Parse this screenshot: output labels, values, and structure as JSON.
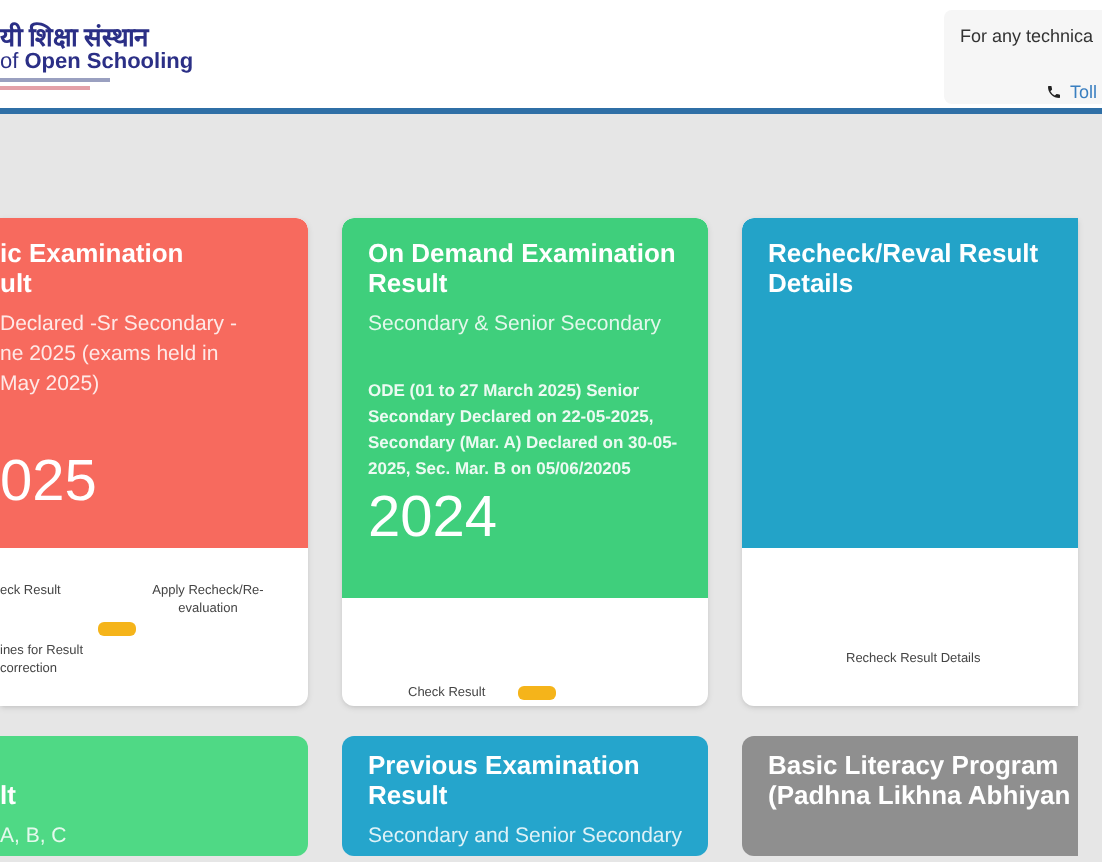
{
  "header": {
    "logo_hindi": "यी शिक्षा संस्थान",
    "logo_english": "of **Open Schooling**",
    "help": {
      "text": "For any technica",
      "phone": "Toll"
    }
  },
  "cards": [
    {
      "title": [
        "ic Examination",
        "ult"
      ],
      "subtitle": [
        "Declared -Sr Secondary -",
        "ne 2025 (exams held in",
        "May 2025)"
      ],
      "year": "025",
      "color": "#f76a5e",
      "links": [
        {
          "label": "eck Result",
          "badge": false
        },
        {
          "label": "Apply Recheck/Re-evaluation",
          "badge": false
        },
        {
          "label": "ines for Result correction",
          "badge": true
        }
      ]
    },
    {
      "title": [
        "On Demand Examination",
        "Result"
      ],
      "subtitle": [
        "Secondary & Senior Secondary"
      ],
      "note": "ODE (01 to 27 March 2025) Senior Secondary Declared on 22-05-2025, Secondary (Mar. A) Declared on 30-05-2025, Sec. Mar. B on 05/06/20205",
      "year": "2024",
      "color": "#3fcf7c",
      "links": [
        {
          "label": "Check Result",
          "badge": true
        }
      ]
    },
    {
      "title": [
        "Recheck/Reval Result",
        "Details"
      ],
      "color": "#23a3c8",
      "links": [
        {
          "label": "Recheck Result Details",
          "badge": false
        }
      ]
    }
  ],
  "cards_row_2": [
    {
      "title": [
        "lt"
      ],
      "subtitle": [
        "A, B, C"
      ],
      "color": "#4fd985"
    },
    {
      "title": [
        "Previous Examination",
        "Result"
      ],
      "subtitle": [
        "Secondary and Senior Secondary"
      ],
      "color": "#25a5cc"
    },
    {
      "title": [
        "Basic Literacy Program",
        "(Padhna Likhna Abhiyan"
      ],
      "color": "#8f8f8f"
    }
  ]
}
